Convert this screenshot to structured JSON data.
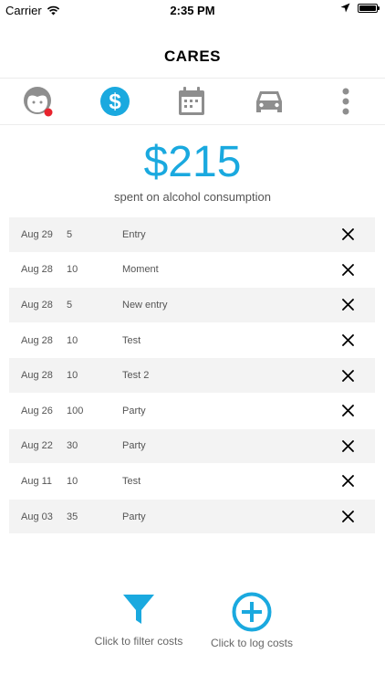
{
  "status": {
    "carrier": "Carrier",
    "time": "2:35 PM"
  },
  "header": {
    "title": "CARES"
  },
  "tabs": [
    {
      "name": "profile",
      "icon": "face-icon"
    },
    {
      "name": "costs",
      "icon": "dollar-icon",
      "active": true
    },
    {
      "name": "calendar",
      "icon": "calendar-icon"
    },
    {
      "name": "car",
      "icon": "car-icon"
    },
    {
      "name": "more",
      "icon": "more-icon"
    }
  ],
  "summary": {
    "amount": "$215",
    "label": "spent on alcohol consumption"
  },
  "entries": [
    {
      "date": "Aug 29",
      "amount": "5",
      "note": "Entry"
    },
    {
      "date": "Aug 28",
      "amount": "10",
      "note": "Moment"
    },
    {
      "date": "Aug 28",
      "amount": "5",
      "note": "New entry"
    },
    {
      "date": "Aug 28",
      "amount": "10",
      "note": "Test"
    },
    {
      "date": "Aug 28",
      "amount": "10",
      "note": "Test 2"
    },
    {
      "date": "Aug 26",
      "amount": "100",
      "note": "Party"
    },
    {
      "date": "Aug 22",
      "amount": "30",
      "note": "Party"
    },
    {
      "date": "Aug 11",
      "amount": "10",
      "note": "Test"
    },
    {
      "date": "Aug 03",
      "amount": "35",
      "note": "Party"
    }
  ],
  "footer": {
    "filter_label": "Click to filter costs",
    "log_label": "Click to log costs"
  },
  "colors": {
    "accent": "#1aa9df",
    "inactive": "#8e8e8e",
    "badge": "#e8232d"
  }
}
